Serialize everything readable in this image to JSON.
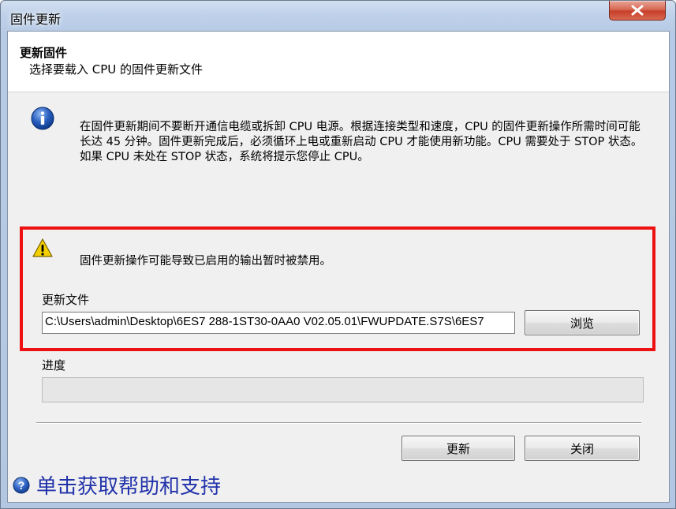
{
  "window": {
    "title": "固件更新"
  },
  "header": {
    "title": "更新固件",
    "subtitle": "选择要载入 CPU 的固件更新文件"
  },
  "info": {
    "icon": "info-icon",
    "text": "在固件更新期间不要断开通信电缆或拆卸 CPU 电源。根据连接类型和速度，CPU 的固件更新操作所需时间可能长达 45 分钟。固件更新完成后，必须循环上电或重新启动 CPU 才能使用新功能。CPU 需要处于 STOP 状态。如果 CPU 未处在 STOP 状态，系统将提示您停止 CPU。"
  },
  "warning": {
    "icon": "warning-icon",
    "text": "固件更新操作可能导致已启用的输出暂时被禁用。"
  },
  "update_file": {
    "label": "更新文件",
    "value": "C:\\Users\\admin\\Desktop\\6ES7 288-1ST30-0AA0 V02.05.01\\FWUPDATE.S7S\\6ES7",
    "browse_label": "浏览"
  },
  "progress": {
    "label": "进度",
    "value_percent": 0
  },
  "buttons": {
    "update_label": "更新",
    "close_label": "关闭"
  },
  "help": {
    "icon": "help-icon",
    "text": "单击获取帮助和支持"
  },
  "colors": {
    "highlight_border": "#ee1111",
    "help_link": "#2233aa"
  }
}
